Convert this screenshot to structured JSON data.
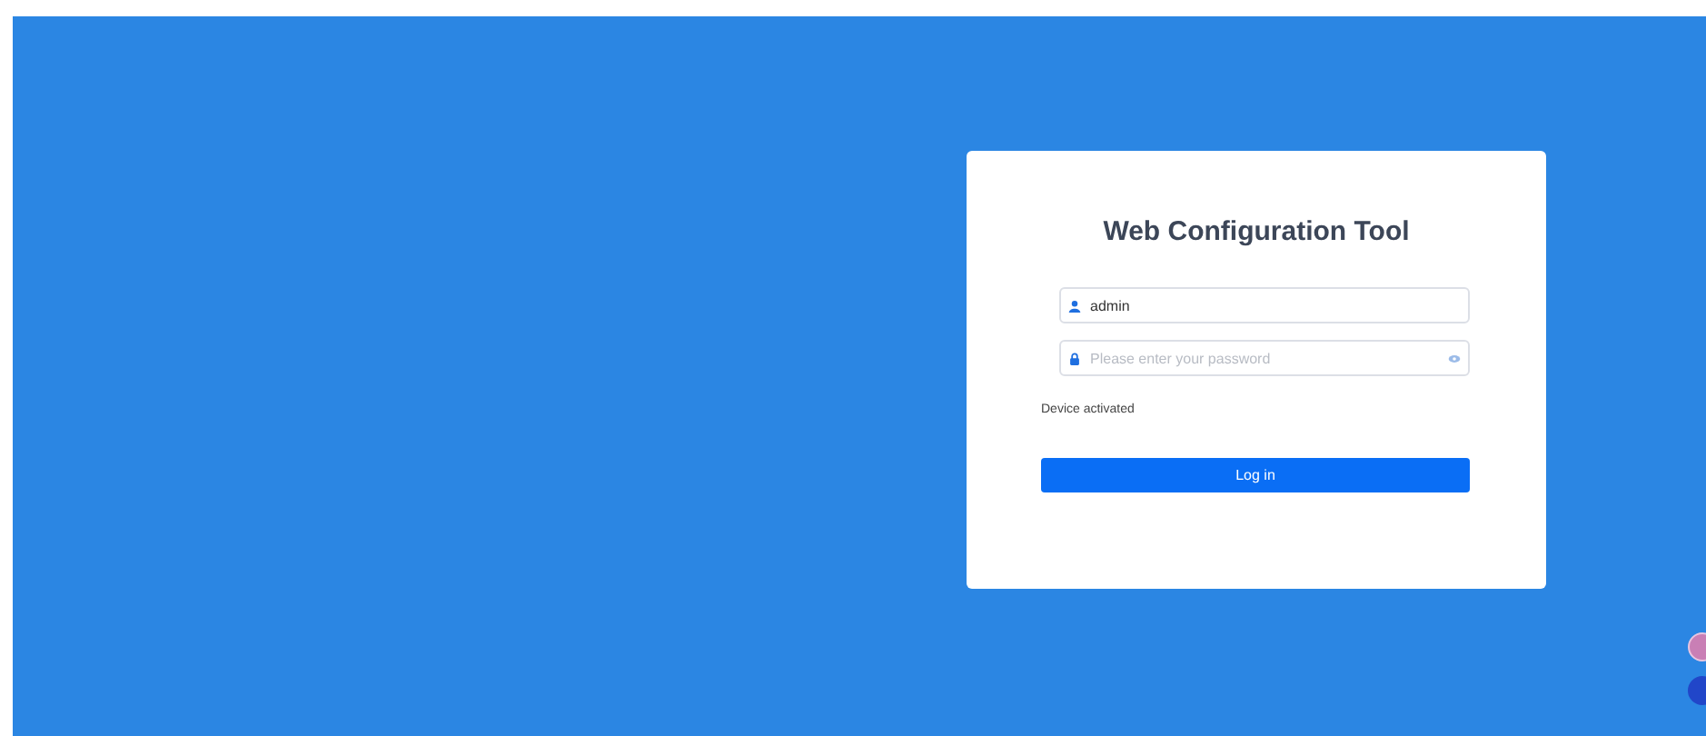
{
  "login": {
    "title": "Web Configuration Tool",
    "username": {
      "value": "admin"
    },
    "password": {
      "placeholder": "Please enter your password"
    },
    "status": "Device activated",
    "button": "Log in"
  }
}
